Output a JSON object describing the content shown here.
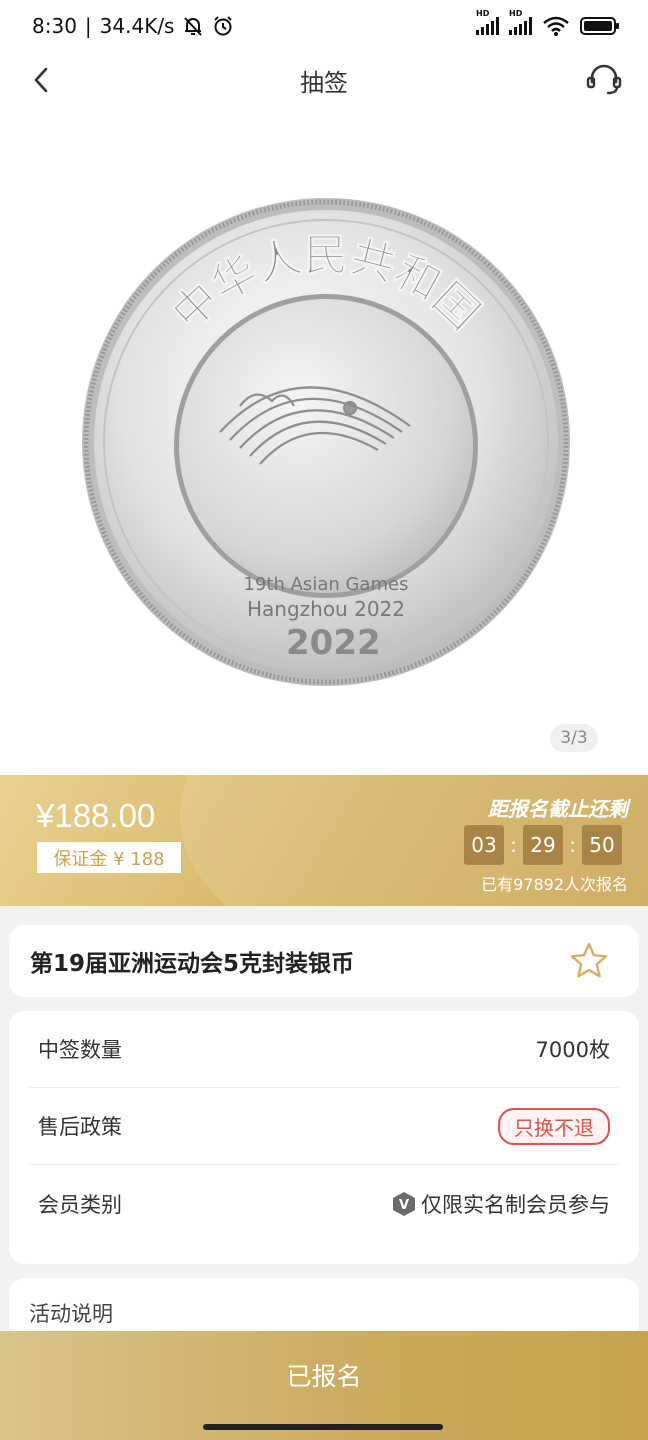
{
  "status_bar": {
    "time": "8:30",
    "network_speed": "34.4K/s",
    "icons": [
      "mute-bell-icon",
      "alarm-icon",
      "signal-hd-icon",
      "signal-hd-icon",
      "wifi-icon",
      "battery-icon"
    ],
    "signal_badge": "HD"
  },
  "header": {
    "title": "抽签",
    "back_icon": "chevron-left-icon",
    "support_icon": "headset-icon"
  },
  "coin": {
    "top_text": "中华人民共和国",
    "center_line_1": "19th Asian Games",
    "center_line_2": "Hangzhou 2022",
    "year": "2022"
  },
  "gallery": {
    "counter": "3/3"
  },
  "price_banner": {
    "price": "¥188.00",
    "deposit": "保证金 ¥ 188",
    "countdown_label": "距报名截止还剩",
    "countdown": {
      "hours": "03",
      "minutes": "29",
      "seconds": "50"
    },
    "countdown_separator": ":",
    "signup_count": "已有97892人次报名"
  },
  "product": {
    "title": "第19届亚洲运动会5克封装银币",
    "favorite_icon": "star-outline-icon"
  },
  "info": {
    "rows": [
      {
        "label": "中签数量",
        "value": "7000枚"
      },
      {
        "label": "售后政策",
        "value": "只换不退"
      },
      {
        "label": "会员类别",
        "value": "仅限实名制会员参与"
      }
    ],
    "member_icon": "verified-member-icon",
    "member_icon_text": "V"
  },
  "description": {
    "title": "活动说明"
  },
  "bottom_button": {
    "label": "已报名"
  },
  "colors": {
    "gold_light": "#e9d191",
    "gold": "#d4b463",
    "gold_dark": "#a88546",
    "tag_red": "#d9534f"
  }
}
